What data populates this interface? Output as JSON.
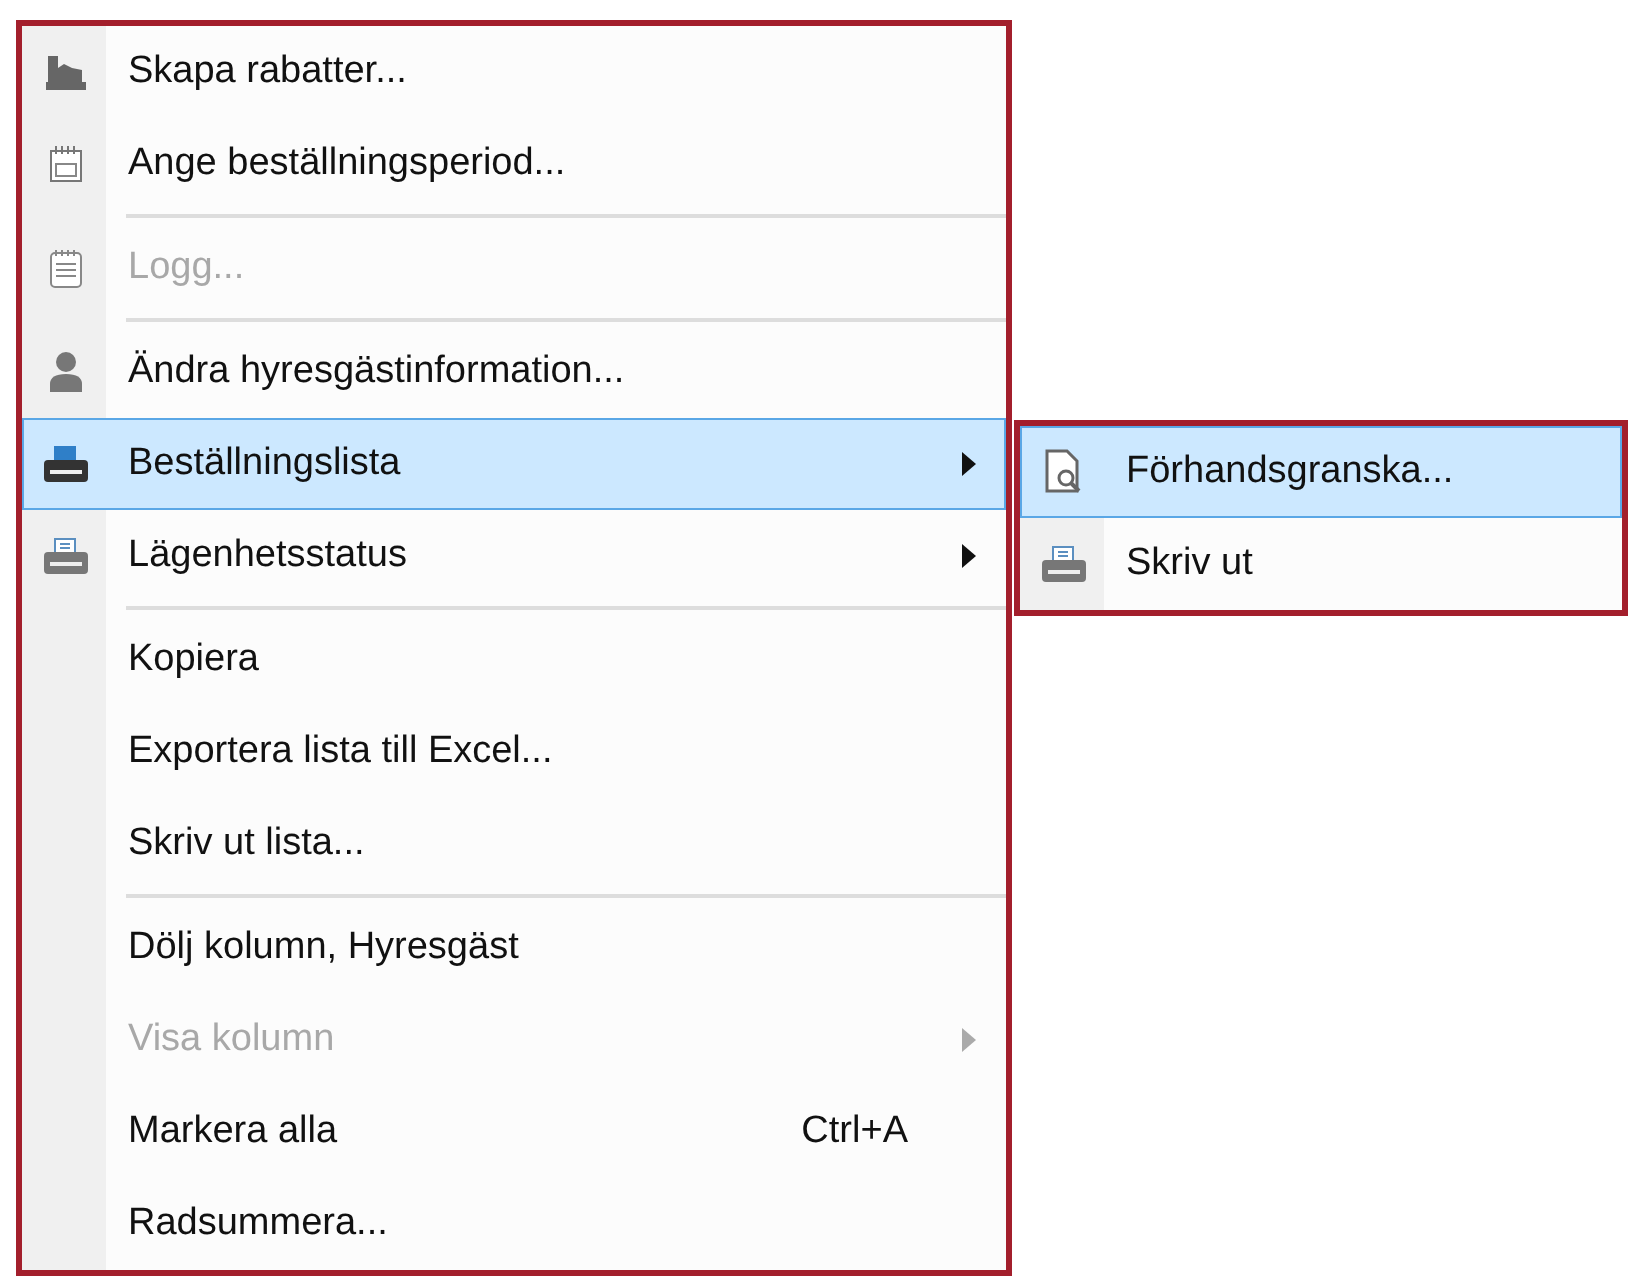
{
  "context_menu": {
    "items": [
      {
        "kind": "item",
        "label": "Skapa rabatter...",
        "disabled": false,
        "selected": false,
        "submenu": false
      },
      {
        "kind": "item",
        "label": "Ange beställningsperiod...",
        "disabled": false,
        "selected": false,
        "submenu": false
      },
      {
        "kind": "separator"
      },
      {
        "kind": "item",
        "label": "Logg...",
        "disabled": true,
        "selected": false,
        "submenu": false
      },
      {
        "kind": "separator"
      },
      {
        "kind": "item",
        "label": "Ändra hyresgästinformation...",
        "disabled": false,
        "selected": false,
        "submenu": false
      },
      {
        "kind": "item",
        "label": "Beställningslista",
        "disabled": false,
        "selected": true,
        "submenu": true
      },
      {
        "kind": "item",
        "label": "Lägenhetsstatus",
        "disabled": false,
        "selected": false,
        "submenu": true
      },
      {
        "kind": "separator"
      },
      {
        "kind": "item",
        "label": "Kopiera",
        "disabled": false,
        "selected": false,
        "submenu": false
      },
      {
        "kind": "item",
        "label": "Exportera lista till Excel...",
        "disabled": false,
        "selected": false,
        "submenu": false
      },
      {
        "kind": "item",
        "label": "Skriv ut lista...",
        "disabled": false,
        "selected": false,
        "submenu": false
      },
      {
        "kind": "separator"
      },
      {
        "kind": "item",
        "label": "Dölj kolumn, Hyresgäst",
        "disabled": false,
        "selected": false,
        "submenu": false
      },
      {
        "kind": "item",
        "label": "Visa kolumn",
        "disabled": true,
        "selected": false,
        "submenu": true
      },
      {
        "kind": "item",
        "label": "Markera alla",
        "shortcut": "Ctrl+A",
        "disabled": false,
        "selected": false,
        "submenu": false
      },
      {
        "kind": "item",
        "label": "Radsummera...",
        "disabled": false,
        "selected": false,
        "submenu": false
      }
    ]
  },
  "submenu": {
    "items": [
      {
        "kind": "item",
        "label": "Förhandsgranska...",
        "disabled": false,
        "selected": true,
        "submenu": false
      },
      {
        "kind": "item",
        "label": "Skriv ut",
        "disabled": false,
        "selected": false,
        "submenu": false
      }
    ]
  }
}
